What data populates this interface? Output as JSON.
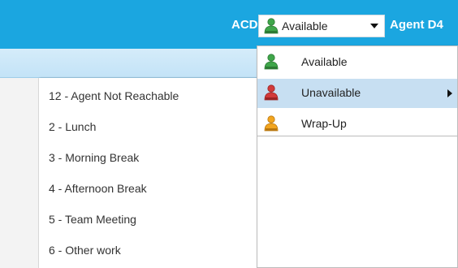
{
  "header": {
    "acd_label": "ACD:",
    "agent_label": "Agent D4",
    "status": {
      "current": "Available",
      "icon": "agent-green-icon"
    }
  },
  "status_menu": {
    "items": [
      {
        "label": "Available",
        "icon": "agent-green-icon",
        "color": "#3fa64a",
        "has_submenu": false,
        "highlighted": false
      },
      {
        "label": "Unavailable",
        "icon": "agent-red-icon",
        "color": "#d23a3a",
        "has_submenu": true,
        "highlighted": true
      },
      {
        "label": "Wrap-Up",
        "icon": "agent-orange-icon",
        "color": "#f2a51f",
        "has_submenu": false,
        "highlighted": false
      }
    ]
  },
  "unavailable_reasons": [
    "12 - Agent Not Reachable",
    "2 - Lunch",
    "3 - Morning Break",
    "4 - Afternoon Break",
    "5 - Team Meeting",
    "6 - Other work"
  ],
  "colors": {
    "header_bg": "#1ba6e0",
    "highlight_bg": "#c7dff2"
  }
}
